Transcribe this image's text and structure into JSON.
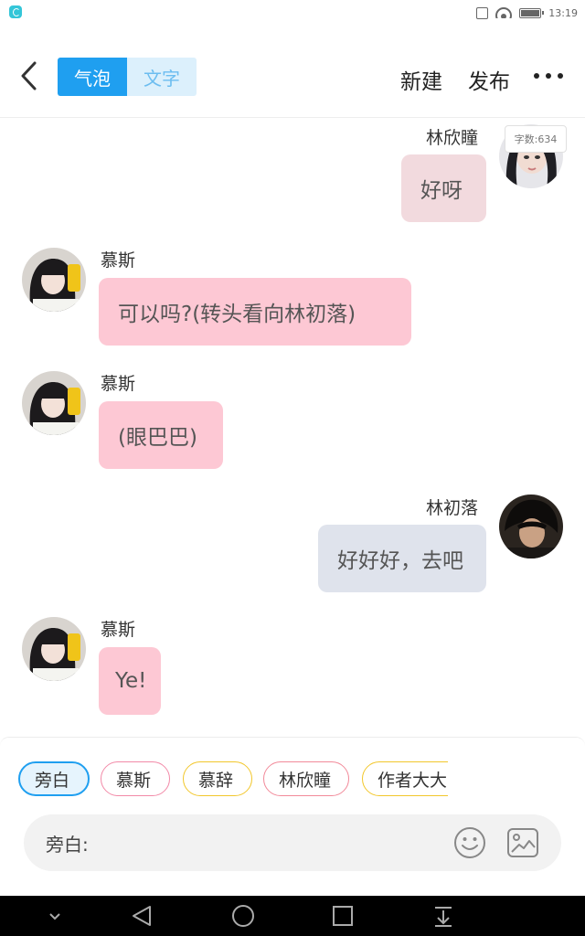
{
  "status_bar": {
    "time": "13:19"
  },
  "header": {
    "back_icon": "chevron-left-icon",
    "tabs": [
      {
        "label": "气泡",
        "active": true
      },
      {
        "label": "文字",
        "active": false
      }
    ],
    "new_label": "新建",
    "publish_label": "发布",
    "more_icon": "more-dots-icon"
  },
  "word_count": "字数:634",
  "messages": [
    {
      "side": "right",
      "name": "林欣瞳",
      "text": "好呀",
      "bubble_color": "#f2dade"
    },
    {
      "side": "left",
      "name": "慕斯",
      "text": "可以吗?(转头看向林初落)",
      "bubble_color": "#fdc8d4"
    },
    {
      "side": "left",
      "name": "慕斯",
      "text": "(眼巴巴)",
      "bubble_color": "#fdc8d4"
    },
    {
      "side": "right",
      "name": "林初落",
      "text": "好好好，去吧",
      "bubble_color": "#dfe3ec"
    },
    {
      "side": "left",
      "name": "慕斯",
      "text": "Ye!",
      "bubble_color": "#fdc8d4"
    }
  ],
  "roles": [
    {
      "label": "旁白",
      "selected": true,
      "border_color": "#1f9ff0"
    },
    {
      "label": "慕斯",
      "selected": false,
      "border_color": "#f28aa8"
    },
    {
      "label": "慕辞",
      "selected": false,
      "border_color": "#f2c72c"
    },
    {
      "label": "林欣瞳",
      "selected": false,
      "border_color": "#f28a9a"
    },
    {
      "label": "作者大大",
      "selected": false,
      "border_color": "#f2c72c"
    }
  ],
  "input": {
    "label": "旁白:",
    "emoji_icon": "smiley-icon",
    "image_icon": "image-icon"
  },
  "nav": [
    "chevron-down-icon",
    "back-triangle-icon",
    "home-circle-icon",
    "recents-square-icon",
    "download-icon"
  ]
}
